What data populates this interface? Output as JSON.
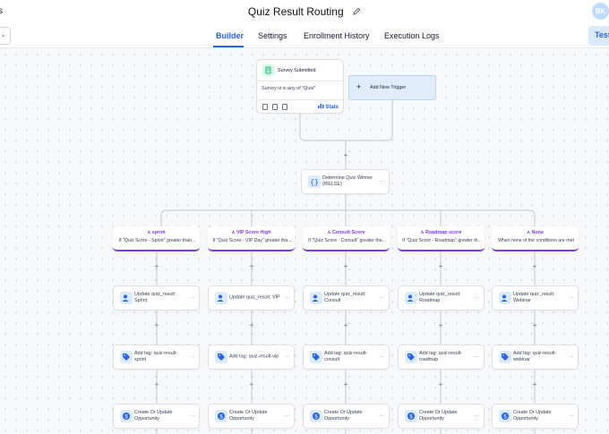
{
  "header": {
    "left_fragment": "s",
    "title": "Quiz Result Routing",
    "avatar_initials": "BK"
  },
  "tabs": [
    {
      "label": "Builder",
      "active": true
    },
    {
      "label": "Settings",
      "active": false
    },
    {
      "label": "Enrollment History",
      "active": false
    },
    {
      "label": "Execution Logs",
      "active": false
    }
  ],
  "test_button": "Test",
  "trigger": {
    "name": "Survey Submitted",
    "condition": "Survey is is any of \"Quiz\"",
    "stats_label": "Stats"
  },
  "add_trigger": "Add New Trigger",
  "if_else": {
    "label": "Determine Quiz Winner (If/ELSE)"
  },
  "branches": [
    {
      "name": "sprint",
      "condition": "If \"Quiz Score - Sprint\" greater than...",
      "update": "Update quiz_result: Sprint",
      "tag": "Add tag: quiz-result-sprint",
      "opportunity": "Create Or Update Opportunity"
    },
    {
      "name": "VIP Score High",
      "condition": "If \"Quiz Score - VIP Day\" greater tha...",
      "update": "Update quiz_result: VIP",
      "tag": "Add tag: quiz-result-vip",
      "opportunity": "Create Or Update Opportunity"
    },
    {
      "name": "Consult Score",
      "condition": "If \"Quiz Score - Consult\" greater tha...",
      "update": "Update quiz_result: Consult",
      "tag": "Add tag: quiz-result-consult",
      "opportunity": "Create Or Update Opportunity"
    },
    {
      "name": "Roadmap score",
      "condition": "If \"Quiz Score - Roadmap\" greater th...",
      "update": "Update quiz_result: Roadmap",
      "tag": "Add tag: quiz-result-roadmap",
      "opportunity": "Create Or Update Opportunity"
    },
    {
      "name": "None",
      "condition": "When none of the conditions are met",
      "update": "Update quiz_result: Webinar",
      "tag": "Add tag: quiz-result-webinar",
      "opportunity": "Create Or Update Opportunity"
    }
  ],
  "colors": {
    "accent": "#2563eb",
    "branch": "#7c3aed",
    "connector": "#c4c8cf"
  },
  "icons": [
    "pencil-icon",
    "document-icon",
    "plus-icon",
    "braces-icon",
    "branch-icon",
    "user-icon",
    "tag-icon",
    "dollar-icon",
    "more-icon"
  ]
}
